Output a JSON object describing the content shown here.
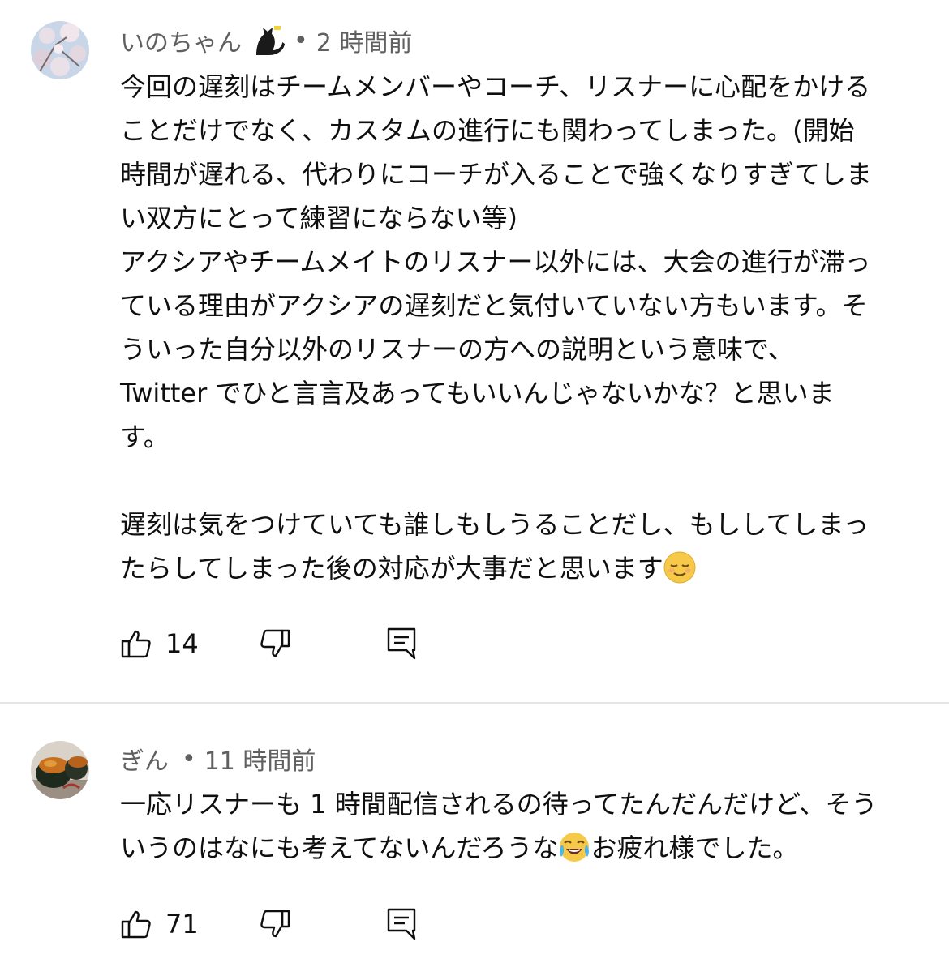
{
  "comments": [
    {
      "author": "いのちゃん",
      "badge": "black-cat-icon",
      "separator": "•",
      "time": "2 時間前",
      "text": "今回の遅刻はチームメンバーやコーチ、リスナーに心配をかける\nことだけでなく、カスタムの進行にも関わってしまった。(開始\n時間が遅れる、代わりにコーチが入ることで強くなりすぎてしま\nい双方にとって練習にならない等)\nアクシアやチームメイトのリスナー以外には、大会の進行が滞っ\nている理由がアクシアの遅刻だと気付いていない方もいます。そ\nういった自分以外のリスナーの方への説明という意味で、\nTwitter でひと言言及あってもいいんじゃないかな？と思いま\nす。\n\n遅刻は気をつけていても誰しもしうることだし、もししてしまっ\nたらしてしまった後の対応が大事だと思います",
      "trailing_emoji": "relieved-face-emoji",
      "likes": "14",
      "avatar": "cherry-blossom-avatar"
    },
    {
      "author": "ぎん",
      "separator": "•",
      "time": "11 時間前",
      "text_part1": "一応リスナーも 1 時間配信されるの待ってたんだんだけど、そう\nいうのはなにも考えてないんだろうな",
      "inline_emoji": "tears-of-joy-emoji",
      "text_part2": "お疲れ様でした。",
      "likes": "71",
      "avatar": "sushi-avatar"
    }
  ],
  "icons": {
    "like": "thumbs-up-icon",
    "dislike": "thumbs-down-icon",
    "reply": "reply-comment-icon"
  },
  "colors": {
    "secondary_text": "#606060",
    "primary_text": "#0f0f0f",
    "divider": "#e5e5e5"
  }
}
